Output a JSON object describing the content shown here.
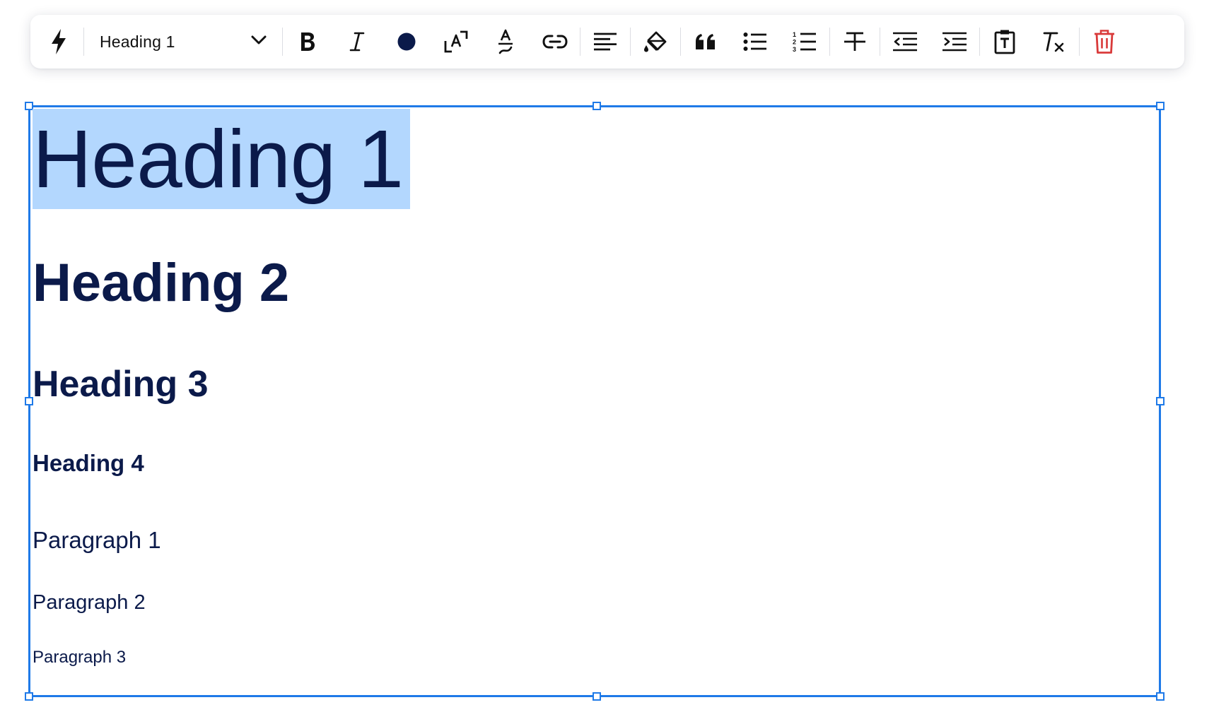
{
  "toolbar": {
    "block_style": {
      "selected": "Heading 1"
    },
    "buttons": [
      "quick-actions",
      "bold",
      "italic",
      "text-color",
      "font-size",
      "highlight",
      "link",
      "align-left",
      "fill",
      "quote",
      "bulleted-list",
      "numbered-list",
      "strikethrough",
      "outdent",
      "indent",
      "paste-as-text",
      "clear-formatting",
      "delete"
    ],
    "text_color": "#0b1a4a",
    "delete_color": "#d93a3a"
  },
  "editor": {
    "selection_color": "#b3d7fe",
    "frame_color": "#1f7ae8",
    "text_color": "#0b1a4a",
    "blocks": {
      "h1": "Heading 1",
      "h2": "Heading 2",
      "h3": "Heading 3",
      "h4": "Heading 4",
      "p1": "Paragraph 1",
      "p2": "Paragraph 2",
      "p3": "Paragraph 3"
    }
  }
}
